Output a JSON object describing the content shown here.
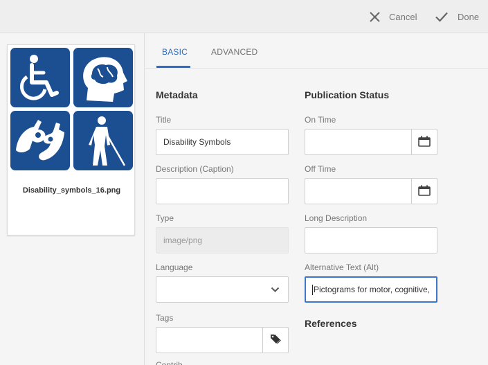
{
  "toolbar": {
    "cancel_label": "Cancel",
    "done_label": "Done",
    "cancel_icon": "close-icon",
    "done_icon": "checkmark-icon"
  },
  "asset": {
    "filename": "Disability_symbols_16.png",
    "thumbnail_icons": [
      "wheelchair-icon",
      "brain-head-icon",
      "sign-language-hands-icon",
      "blind-person-cane-icon"
    ],
    "thumbnail_color": "#1b4f92"
  },
  "tabs": [
    {
      "label": "BASIC",
      "active": true
    },
    {
      "label": "ADVANCED",
      "active": false
    }
  ],
  "metadata": {
    "heading": "Metadata",
    "title_label": "Title",
    "title_value": "Disability Symbols",
    "description_label": "Description (Caption)",
    "description_value": "",
    "type_label": "Type",
    "type_value": "image/png",
    "language_label": "Language",
    "language_value": "",
    "tags_label": "Tags",
    "tags_value": "",
    "next_label_partial": "Contrib..."
  },
  "publication": {
    "heading": "Publication Status",
    "on_time_label": "On Time",
    "on_time_value": "",
    "off_time_label": "Off Time",
    "off_time_value": "",
    "long_description_label": "Long Description",
    "long_description_value": "",
    "alt_text_label": "Alternative Text (Alt)",
    "alt_text_value": "Pictograms for motor, cognitive,"
  },
  "references": {
    "heading": "References"
  },
  "colors": {
    "accent": "#2c6bc4",
    "focus_border": "#3d75c9"
  }
}
